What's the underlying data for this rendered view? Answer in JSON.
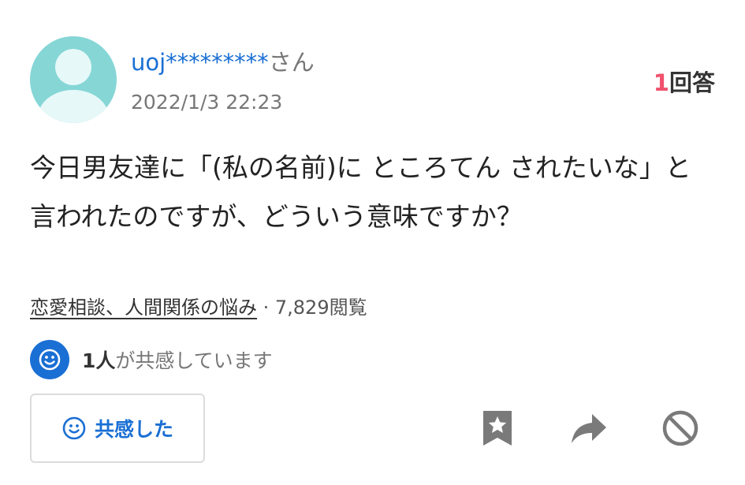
{
  "user": {
    "name": "uoj*********",
    "suffix": "さん",
    "timestamp": "2022/1/3 22:23"
  },
  "answers": {
    "count": "1",
    "label": "回答"
  },
  "question": {
    "text": "今日男友達に「(私の名前)に ところてん されたいな」と言われたのですが、どういう意味ですか？"
  },
  "meta": {
    "category": "恋愛相談、人間関係の悩み",
    "separator": " · ",
    "views": "7,829閲覧"
  },
  "empathy": {
    "count": "1人",
    "text": "が共感しています"
  },
  "actions": {
    "empathize_label": "共感した",
    "icons": [
      "smile-icon",
      "bookmark-star-icon",
      "share-icon",
      "block-icon"
    ]
  },
  "colors": {
    "accent": "#1a6fd4",
    "answer_count": "#f0516c",
    "muted": "#777777",
    "icon_gray": "#7a7a7a",
    "avatar": "#86d6d6"
  }
}
